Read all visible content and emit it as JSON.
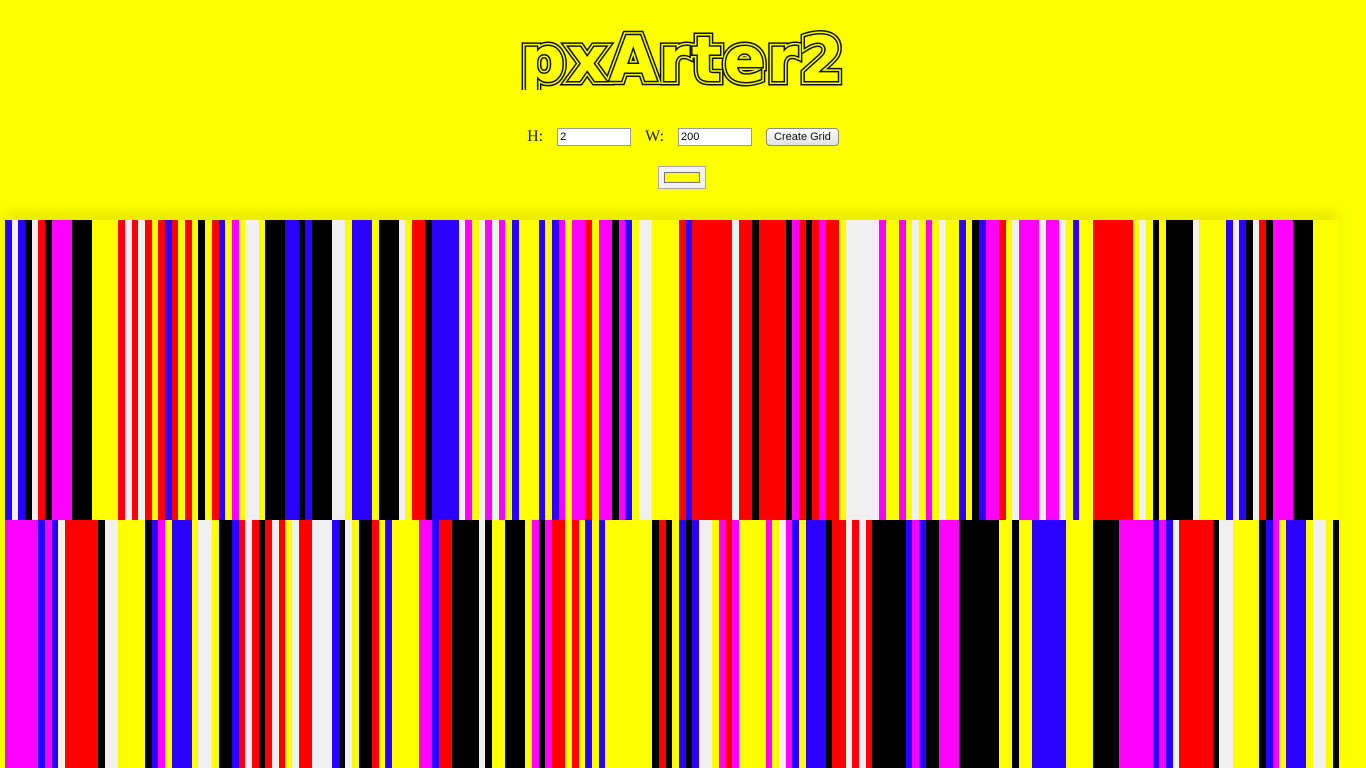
{
  "app": {
    "title": "pxArter2"
  },
  "controls": {
    "height_label": "H:",
    "height_value": "2",
    "width_label": "W:",
    "width_value": "200",
    "create_button_label": "Create Grid"
  },
  "color_picker": {
    "value": "#fbff00"
  },
  "palette": {
    "Y": "#fbff00",
    "R": "#ff0000",
    "B": "#2a00ff",
    "K": "#000000",
    "M": "#ff00ff",
    "W": "#f0f0f0"
  },
  "grid": {
    "rows": 2,
    "cols": 200,
    "row_patterns": [
      "BWBKWRKMMMKKKYYYYRWRWRYRBRYRYKYRBYMYWWYKKKBBKBKKKWWYBBBYKKKWYRRKBBBBWMYWMWMYBYYYBYBMYMMRYMMKMBYWWYYYYRBRRRRRRWRRKRRRRKMRKRMRRYWWWWWMYYMYWYMYWYYBYKBMMRYWMMMWMMWYBYYRRRRRRYWYKYKKKKWYYYY",
      "MMMMMBMBWRRRRRKWWYYYYKBMYBBBYWWYKKBRWRKRWRYWRRWWWBKWYKKRYBYYYYMMBRRKKKKWKYYKKKYMKMRRYRYBYBYYYYYYYKRKYBKBWWYMRMYYYYMYWMBYBBBKRRWRWRKKKKKBMBKKMMMKKKKKKYYKYYBBBBBYYYYKKKK"
    ]
  }
}
